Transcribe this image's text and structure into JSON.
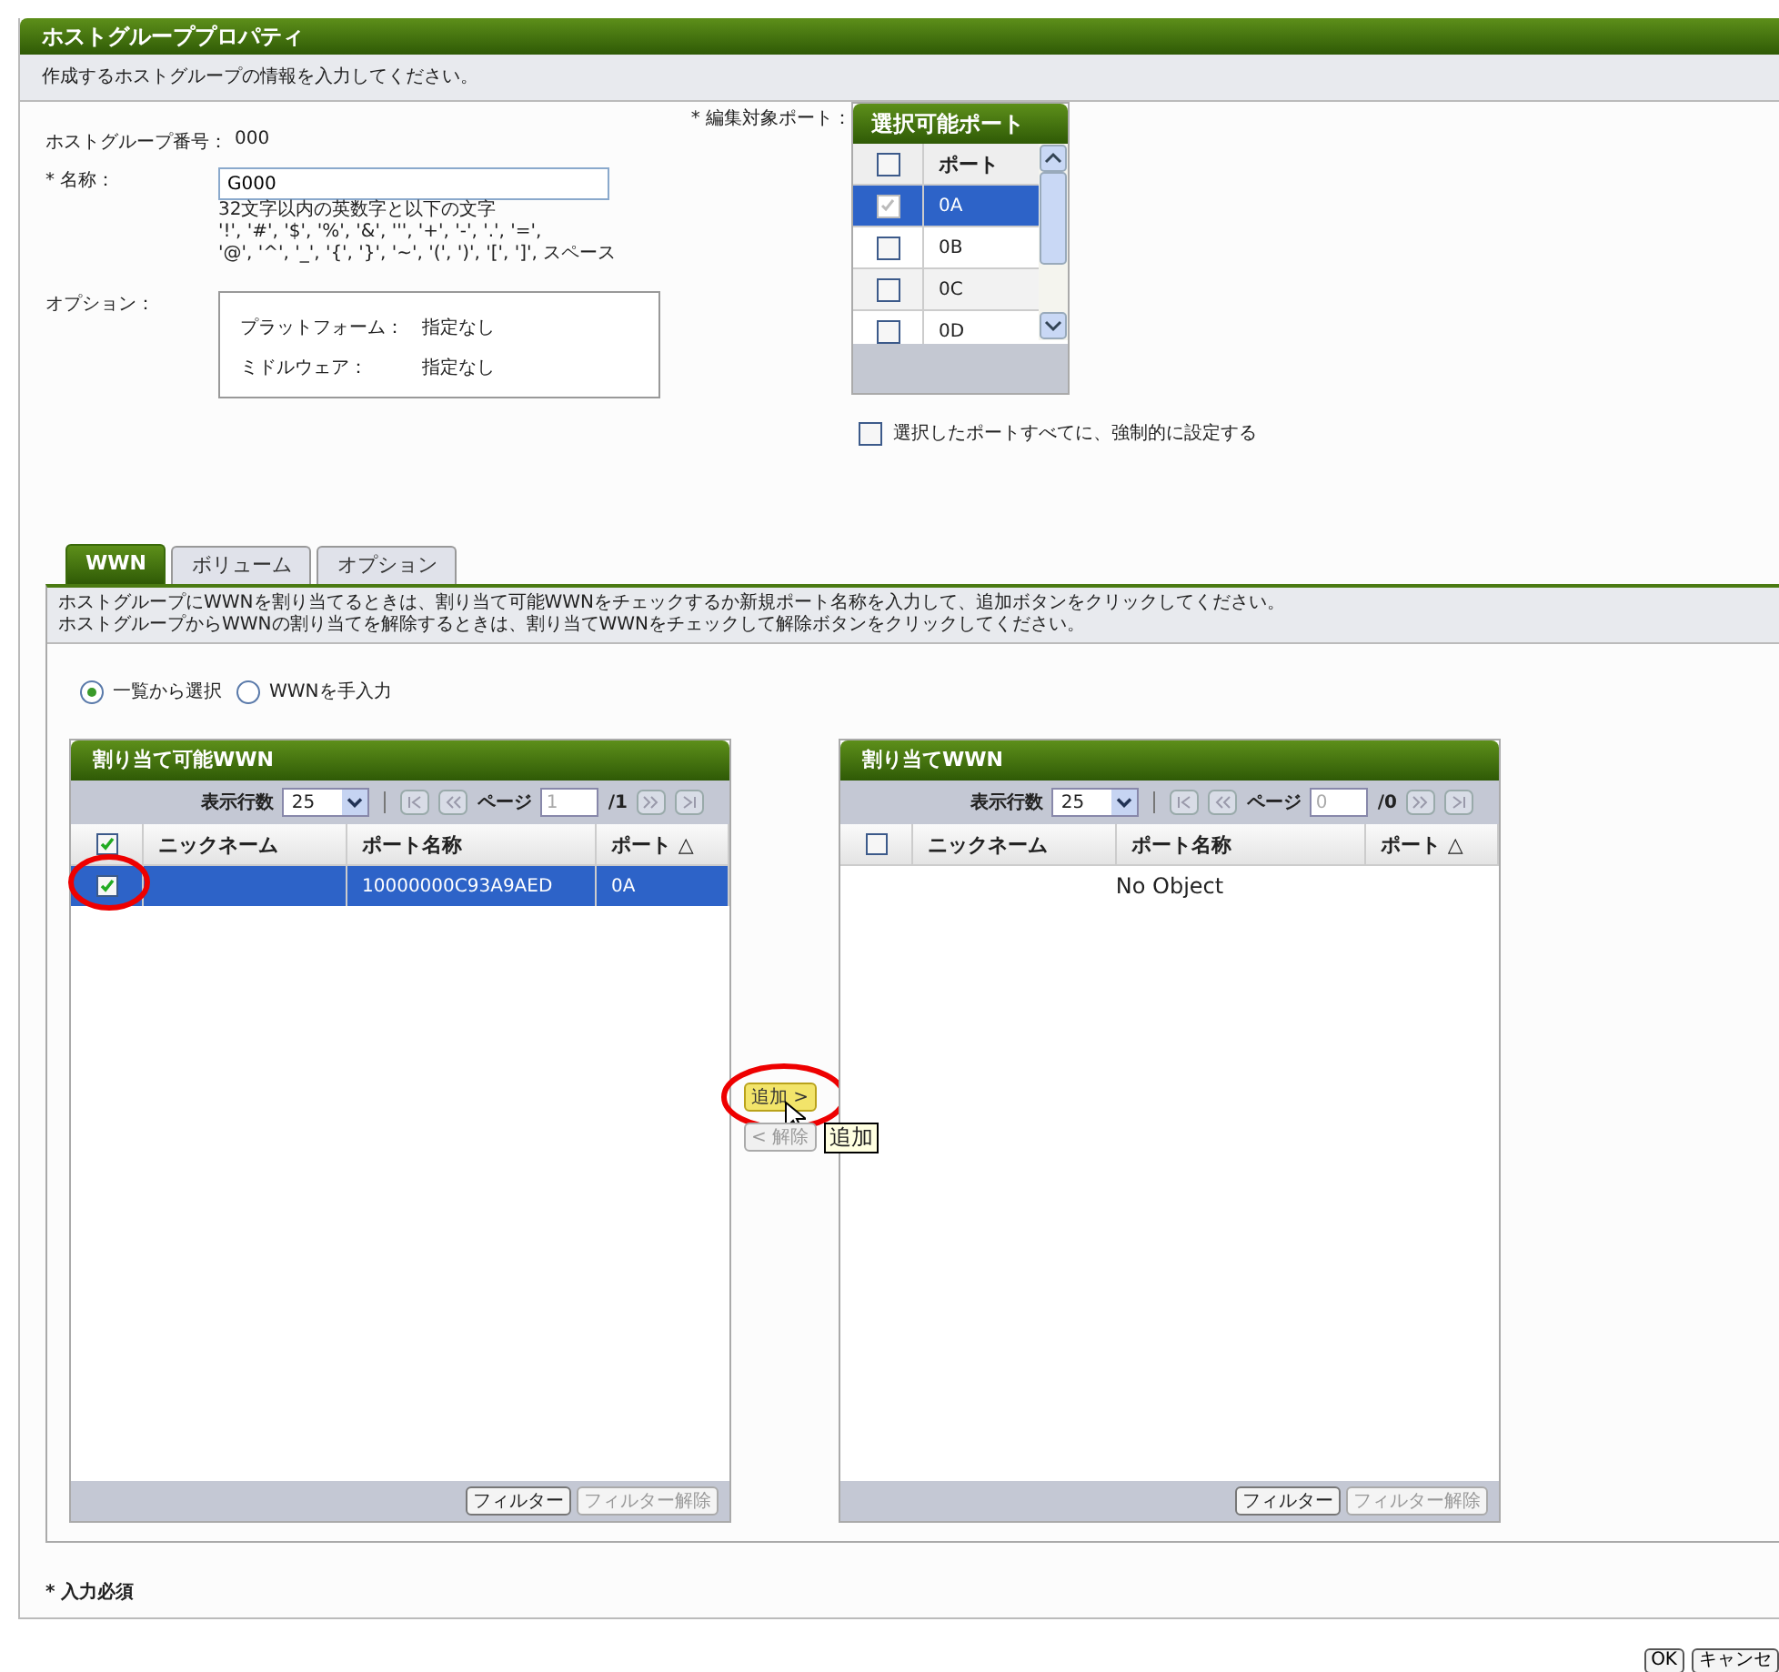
{
  "window": {
    "title": "ホストグループプロパティ"
  },
  "subtitle": "作成するホストグループの情報を入力してください。",
  "host_group_number": {
    "label": "ホストグループ番号：",
    "value": "000"
  },
  "name": {
    "label": "* 名称：",
    "value": "G000",
    "hint": [
      "32文字以内の英数字と以下の文字",
      "'!', '#', '$', '%', '&', ''', '+', '-', '.', '=',",
      "'@', '^', '_', '{', '}', '~', '(', ')', '[', ']', スペース"
    ]
  },
  "options": {
    "label": "オプション：",
    "items": [
      {
        "label": "プラットフォーム：",
        "value": "指定なし"
      },
      {
        "label": "ミドルウェア：",
        "value": "指定なし"
      }
    ]
  },
  "port_select": {
    "label": "* 編集対象ポート：",
    "title": "選択可能ポート",
    "column": "ポート",
    "header_checked": false,
    "rows": [
      {
        "port": "0A",
        "checked": true,
        "selected": true
      },
      {
        "port": "0B",
        "checked": false,
        "selected": false
      },
      {
        "port": "0C",
        "checked": false,
        "selected": false
      },
      {
        "port": "0D",
        "checked": false,
        "selected": false
      }
    ]
  },
  "force_all": {
    "label": "選択したポートすべてに、強制的に設定する",
    "checked": false
  },
  "tabs": [
    {
      "label": "WWN",
      "selected": true
    },
    {
      "label": "ボリューム",
      "selected": false
    },
    {
      "label": "オプション",
      "selected": false
    }
  ],
  "description": [
    "ホストグループにWWNを割り当てるときは、割り当て可能WWNをチェックするか新規ポート名称を入力して、追加ボタンをクリックしてください。",
    "ホストグループからWWNの割り当てを解除するときは、割り当てWWNをチェックして解除ボタンをクリックしてください。"
  ],
  "mode_radios": [
    {
      "label": "一覧から選択",
      "selected": true
    },
    {
      "label": "WWNを手入力",
      "selected": false
    }
  ],
  "panels": [
    {
      "title": "割り当て可能WWN",
      "rows_per_page_label": "表示行数",
      "rows_per_page": "25",
      "page_label": "ページ",
      "page_placeholder": "1",
      "total": "/1",
      "header_checked": true,
      "columns": [
        "ニックネーム",
        "ポート名称",
        "ポート △"
      ],
      "rows": [
        {
          "port_name": "10000000C93A9AED",
          "port": "0A",
          "checked": true,
          "selected": true
        }
      ],
      "buttons": [
        {
          "label": "フィルター",
          "disabled": false
        },
        {
          "label": "フィルター解除",
          "disabled": true
        }
      ]
    },
    {
      "title": "割り当てWWN",
      "rows_per_page_label": "表示行数",
      "rows_per_page": "25",
      "page_label": "ページ",
      "page_placeholder": "0",
      "total": "/0",
      "header_checked": false,
      "columns": [
        "ニックネーム",
        "ポート名称",
        "ポート △"
      ],
      "empty_text": "No Object",
      "buttons": [
        {
          "label": "フィルター",
          "disabled": false
        },
        {
          "label": "フィルター解除",
          "disabled": true
        }
      ]
    }
  ],
  "transfer_buttons": [
    {
      "label": "追加 >",
      "hovered": true,
      "disabled": false
    },
    {
      "label": "< 解除",
      "hovered": false,
      "disabled": true
    }
  ],
  "tooltip": "追加",
  "required_note": "* 入力必須",
  "dialog_buttons": [
    "OK",
    "キャンセ"
  ]
}
